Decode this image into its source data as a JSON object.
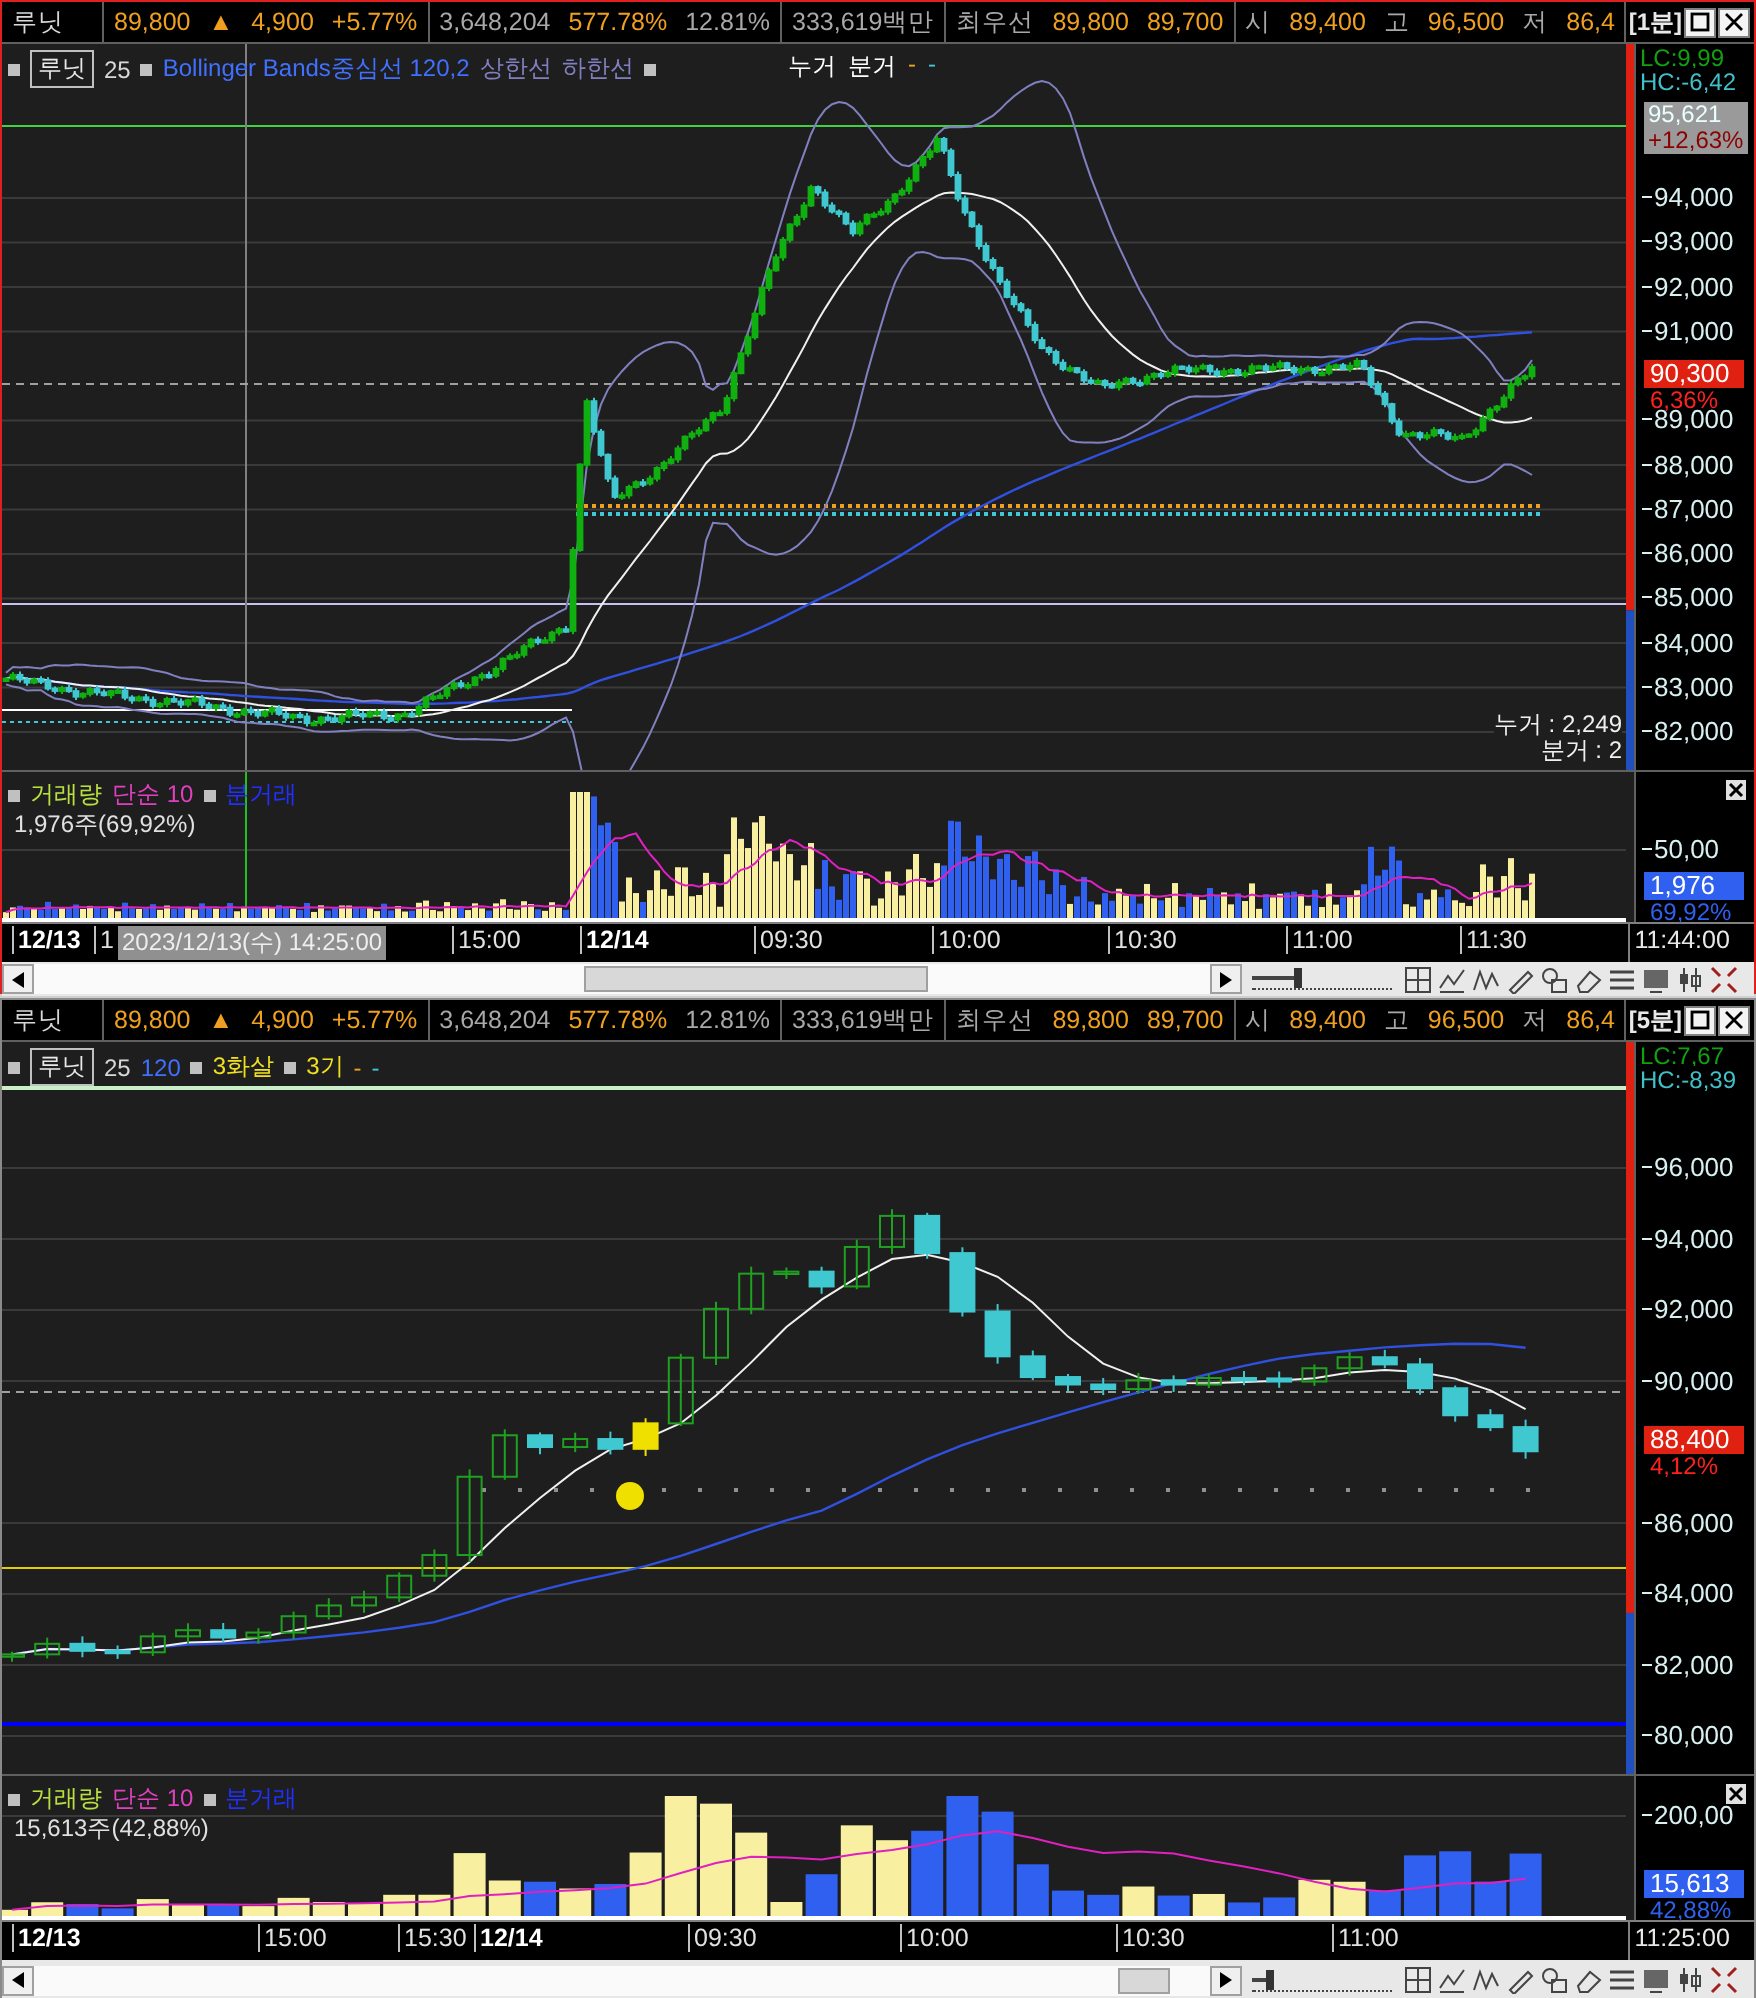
{
  "panels": [
    {
      "focused": true,
      "interval": "[1분]",
      "header": [
        [
          {
            "text": "루닛",
            "color": "#d8d8d8"
          }
        ],
        [
          {
            "text": "89,800",
            "color": "#f0a020"
          },
          {
            "text": "▲",
            "color": "#f0a020"
          },
          {
            "text": "4,900",
            "color": "#f0a020"
          },
          {
            "text": "+5.77%",
            "color": "#f0a020"
          }
        ],
        [
          {
            "text": "3,648,204",
            "color": "#a8a8a8"
          },
          {
            "text": "577.78%",
            "color": "#f0a020"
          },
          {
            "text": "12.81%",
            "color": "#a8a8a8"
          }
        ],
        [
          {
            "text": "333,619백만",
            "color": "#a8a8a8"
          }
        ],
        [
          {
            "text": "최우선",
            "color": "#a8a8a8"
          },
          {
            "text": "89,800",
            "color": "#f0a020"
          },
          {
            "text": "89,700",
            "color": "#f0a020"
          }
        ],
        [
          {
            "text": "시",
            "color": "#a8a8a8"
          },
          {
            "text": "89,400",
            "color": "#f0a020"
          },
          {
            "text": "고",
            "color": "#a8a8a8"
          },
          {
            "text": "96,500",
            "color": "#f0a020"
          },
          {
            "text": "저",
            "color": "#a8a8a8"
          },
          {
            "text": "86,4",
            "color": "#f0a020"
          }
        ]
      ],
      "legend": [
        {
          "kind": "marker"
        },
        {
          "kind": "boxed",
          "text": "루닛"
        },
        {
          "kind": "text",
          "text": "25",
          "color": "#d8d8d8"
        },
        {
          "kind": "marker"
        },
        {
          "kind": "text",
          "text": "Bollinger Bands중심선 120,2",
          "color": "#4070ff"
        },
        {
          "kind": "text",
          "text": "상한선",
          "color": "#8080c0"
        },
        {
          "kind": "text",
          "text": "하한선",
          "color": "#8080c0"
        },
        {
          "kind": "marker"
        }
      ],
      "cum_legend": [
        {
          "kind": "text",
          "text": "누거",
          "color": "#ffffff"
        },
        {
          "kind": "text",
          "text": "분거",
          "color": "#ffffff"
        },
        {
          "kind": "text",
          "text": "-",
          "color": "#f0a020"
        },
        {
          "kind": "text",
          "text": "-",
          "color": "#40c8d8"
        }
      ],
      "cum_values": [
        "누거 : 2,249",
        "분거 : 2"
      ],
      "axis": {
        "lc": "LC:9,99",
        "hc": "HC:-6,42",
        "high": {
          "price": "95,621",
          "pct": "+12,63%"
        },
        "ticks": [
          "94,000",
          "93,000",
          "92,000",
          "91,000",
          "89,000",
          "88,000",
          "87,000",
          "86,000",
          "85,000",
          "84,000",
          "83,000",
          "82,000"
        ],
        "current": {
          "price": "90,300",
          "pct": "6,36%"
        }
      },
      "volume": {
        "legend": [
          {
            "kind": "marker"
          },
          {
            "kind": "text",
            "text": "거래량",
            "color": "#b8e040"
          },
          {
            "kind": "text",
            "text": "단순 10",
            "color": "#e040c0"
          },
          {
            "kind": "marker"
          },
          {
            "kind": "text",
            "text": "분거래",
            "color": "#2030ff"
          }
        ],
        "summary": "1,976주(69,92%)",
        "tick": "50,00",
        "current": {
          "value": "1,976",
          "pct": "69,92%"
        }
      },
      "time": {
        "labels": [
          {
            "kind": "date",
            "text": "12/13"
          },
          {
            "kind": "time",
            "text": "1"
          },
          {
            "kind": "time",
            "text": "15:00"
          },
          {
            "kind": "date",
            "text": "12/14"
          },
          {
            "kind": "time",
            "text": "09:30"
          },
          {
            "kind": "time",
            "text": "10:00"
          },
          {
            "kind": "time",
            "text": "10:30"
          },
          {
            "kind": "time",
            "text": "11:00"
          },
          {
            "kind": "time",
            "text": "11:30"
          }
        ],
        "cursor": "2023/12/13(수) 14:25:00",
        "end": "11:44:00"
      },
      "zoom": {
        "level": 0.3
      }
    },
    {
      "focused": false,
      "interval": "[5분]",
      "header": [
        [
          {
            "text": "루닛",
            "color": "#d8d8d8"
          }
        ],
        [
          {
            "text": "89,800",
            "color": "#f0a020"
          },
          {
            "text": "▲",
            "color": "#f0a020"
          },
          {
            "text": "4,900",
            "color": "#f0a020"
          },
          {
            "text": "+5.77%",
            "color": "#f0a020"
          }
        ],
        [
          {
            "text": "3,648,204",
            "color": "#a8a8a8"
          },
          {
            "text": "577.78%",
            "color": "#f0a020"
          },
          {
            "text": "12.81%",
            "color": "#a8a8a8"
          }
        ],
        [
          {
            "text": "333,619백만",
            "color": "#a8a8a8"
          }
        ],
        [
          {
            "text": "최우선",
            "color": "#a8a8a8"
          },
          {
            "text": "89,800",
            "color": "#f0a020"
          },
          {
            "text": "89,700",
            "color": "#f0a020"
          }
        ],
        [
          {
            "text": "시",
            "color": "#a8a8a8"
          },
          {
            "text": "89,400",
            "color": "#f0a020"
          },
          {
            "text": "고",
            "color": "#a8a8a8"
          },
          {
            "text": "96,500",
            "color": "#f0a020"
          },
          {
            "text": "저",
            "color": "#a8a8a8"
          },
          {
            "text": "86,4",
            "color": "#f0a020"
          }
        ]
      ],
      "legend": [
        {
          "kind": "marker"
        },
        {
          "kind": "boxed",
          "text": "루닛"
        },
        {
          "kind": "text",
          "text": "25",
          "color": "#d8d8d8"
        },
        {
          "kind": "text",
          "text": "120",
          "color": "#4070ff"
        },
        {
          "kind": "marker"
        },
        {
          "kind": "text",
          "text": "3화살",
          "color": "#f0e020"
        },
        {
          "kind": "marker"
        },
        {
          "kind": "text",
          "text": "3기",
          "color": "#f0e020"
        },
        {
          "kind": "text",
          "text": "-",
          "color": "#f0a020"
        },
        {
          "kind": "text",
          "text": "-",
          "color": "#40c8d8"
        }
      ],
      "axis": {
        "lc": "LC:7,67",
        "hc": "HC:-8,39",
        "ticks": [
          "96,000",
          "94,000",
          "92,000",
          "90,000",
          "86,000",
          "84,000",
          "82,000",
          "80,000"
        ],
        "current": {
          "price": "88,400",
          "pct": "4,12%"
        }
      },
      "volume": {
        "legend": [
          {
            "kind": "marker"
          },
          {
            "kind": "text",
            "text": "거래량",
            "color": "#b8e040"
          },
          {
            "kind": "text",
            "text": "단순 10",
            "color": "#e040c0"
          },
          {
            "kind": "marker"
          },
          {
            "kind": "text",
            "text": "분거래",
            "color": "#2030ff"
          }
        ],
        "summary": "15,613주(42,88%)",
        "tick": "200,00",
        "current": {
          "value": "15,613",
          "pct": "42,88%"
        }
      },
      "time": {
        "labels": [
          {
            "kind": "date",
            "text": "12/13"
          },
          {
            "kind": "time",
            "text": "15:00"
          },
          {
            "kind": "time",
            "text": "15:30"
          },
          {
            "kind": "date",
            "text": "12/14"
          },
          {
            "kind": "time",
            "text": "09:30"
          },
          {
            "kind": "time",
            "text": "10:00"
          },
          {
            "kind": "time",
            "text": "10:30"
          },
          {
            "kind": "time",
            "text": "11:00"
          }
        ],
        "end": "11:25:00"
      },
      "zoom": {
        "level": 0.1
      }
    }
  ]
}
